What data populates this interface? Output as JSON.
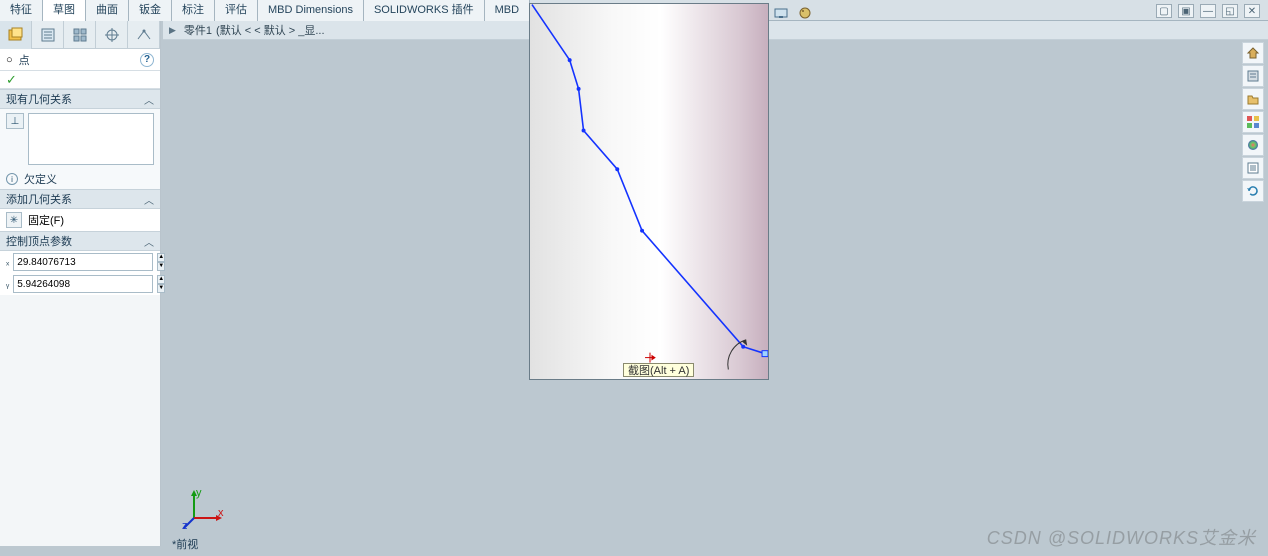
{
  "ribbon": {
    "tabs": [
      "特征",
      "草图",
      "曲面",
      "钣金",
      "标注",
      "评估",
      "MBD Dimensions",
      "SOLIDWORKS 插件",
      "MBD"
    ],
    "active_index": 1
  },
  "breadcrumb": {
    "part": "零件1",
    "state": "(默认 < < 默认 > _显..."
  },
  "property_manager": {
    "title": "点",
    "help_label": "?",
    "ok_glyph": "✓",
    "sections": {
      "existing_relations_head": "现有几何关系",
      "rel_icon": "⊥",
      "under_defined_label": "欠定义",
      "add_relations_head": "添加几何关系",
      "fixed_label": "固定(F)",
      "fixed_icon": "✳",
      "params_head": "控制顶点参数",
      "x_label": "ₓ",
      "y_label": "ᵧ",
      "x_value": "29.84076713",
      "y_value": "5.94264098"
    }
  },
  "viewport_toolbar": {
    "icons": [
      "zoom-fit",
      "zoom-area",
      "prev-view",
      "section",
      "view-orient",
      "display-style",
      "hide-show",
      "",
      "appearance",
      "scene",
      "render"
    ]
  },
  "tooltip": {
    "text": "截图(Alt + A)"
  },
  "right_pane": {
    "icons": [
      "home",
      "resources",
      "open",
      "appearances",
      "color",
      "properties",
      "reload"
    ]
  },
  "window_controls": {
    "labels": [
      "▢",
      "▣",
      "—",
      "◱",
      "✕"
    ]
  },
  "triad": {
    "x": "x",
    "y": "y",
    "z": "z"
  },
  "status_bar": {
    "text": "*前视"
  },
  "watermark": {
    "text": "CSDN @SOLIDWORKS艾金米"
  }
}
